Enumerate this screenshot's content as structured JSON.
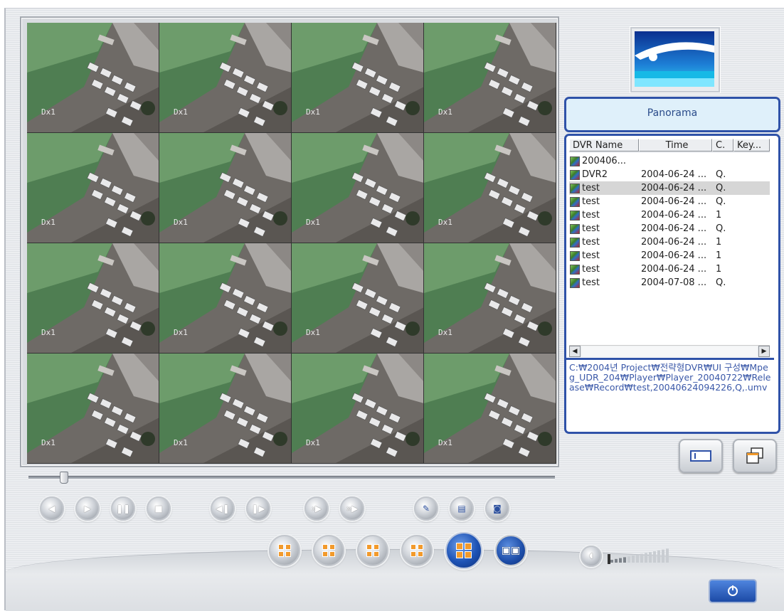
{
  "channel_label": "Dx1",
  "title": "Panorama",
  "list": {
    "columns": [
      "DVR Name",
      "Time",
      "C.",
      "Key..."
    ],
    "rows": [
      {
        "name": "200406...",
        "time": "",
        "c": ""
      },
      {
        "name": "DVR2",
        "time": "2004-06-24 ...",
        "c": "Q."
      },
      {
        "name": "test",
        "time": "2004-06-24 ...",
        "c": "Q.",
        "selected": true
      },
      {
        "name": "test",
        "time": "2004-06-24 ...",
        "c": "Q."
      },
      {
        "name": "test",
        "time": "2004-06-24 ...",
        "c": "1"
      },
      {
        "name": "test",
        "time": "2004-06-24 ...",
        "c": "Q."
      },
      {
        "name": "test",
        "time": "2004-06-24 ...",
        "c": "1"
      },
      {
        "name": "test",
        "time": "2004-06-24 ...",
        "c": "1"
      },
      {
        "name": "test",
        "time": "2004-06-24 ...",
        "c": "1"
      },
      {
        "name": "test",
        "time": "2004-07-08 ...",
        "c": "Q."
      }
    ]
  },
  "file_path": "C:₩2004년 Project₩전략형DVR₩UI 구성₩Mpeg_UDR_204₩Player₩Player_20040722₩Release₩Record₩test,20040624094226,Q,.umv",
  "icons": {
    "rewind": "rewind-icon",
    "play": "play-icon",
    "pause": "pause-icon",
    "stop": "stop-icon",
    "prev_frame": "step-back-icon",
    "next_frame": "step-forward-icon",
    "slow": "slow-play-icon",
    "fast": "fast-play-icon",
    "edit": "edit-icon",
    "print": "print-icon",
    "snapshot": "camera-icon",
    "layout": "quad-layout-icon",
    "multi": "multi-screen-icon",
    "speaker": "speaker-icon",
    "power": "power-icon"
  },
  "playback_position": 0.06,
  "volume_level": 0.25,
  "colors": {
    "accent": "#2f52a8",
    "title_bg": "#dff0fa",
    "layout_orange": "#f29a2c"
  }
}
